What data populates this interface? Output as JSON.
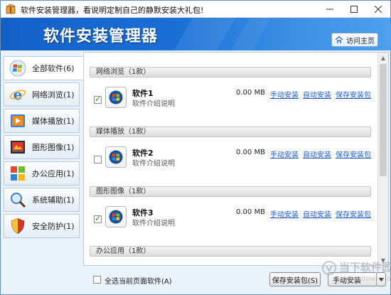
{
  "window": {
    "title": "软件安装管理器，看说明定制自己的静默安装大礼包!",
    "icon": "app-package-icon"
  },
  "banner": {
    "title": "软件安装管理器",
    "visit_label": "访问主页"
  },
  "sidebar": {
    "items": [
      {
        "label": "全部软件(6)",
        "icon": "windows-logo-icon"
      },
      {
        "label": "网络浏览(1)",
        "icon": "ie-browser-icon"
      },
      {
        "label": "媒体播放(1)",
        "icon": "media-play-icon"
      },
      {
        "label": "图形图像(1)",
        "icon": "image-editor-icon"
      },
      {
        "label": "办公应用(1)",
        "icon": "office-icon"
      },
      {
        "label": "系统辅助(1)",
        "icon": "magnifier-icon"
      },
      {
        "label": "安全防护(1)",
        "icon": "shield-icon"
      }
    ]
  },
  "content": {
    "categories": [
      {
        "label": "网络浏览（1款）"
      },
      {
        "label": "媒体播放（1款）"
      },
      {
        "label": "图形图像（1款）"
      },
      {
        "label": "办公应用（1款）"
      }
    ],
    "software": [
      {
        "name": "软件1",
        "desc": "软件介绍说明",
        "size": "0.00 MB",
        "manual": "手动安装",
        "auto": "自动安装",
        "save": "保存安装包",
        "checked": true
      },
      {
        "name": "软件2",
        "desc": "软件介绍说明",
        "size": "0.00 MB",
        "manual": "手动安装",
        "auto": "自动安装",
        "save": "保存安装包",
        "checked": false
      },
      {
        "name": "软件3",
        "desc": "软件介绍说明",
        "size": "0.00 MB",
        "manual": "手动安装",
        "auto": "自动安装",
        "save": "保存安装包",
        "checked": true
      }
    ]
  },
  "footer": {
    "select_all_label": "全选当前页面软件(A)",
    "save_label": "保存安装包(S)",
    "manual_label": "手动安装"
  },
  "watermark": {
    "text": "当下软件园",
    "url": "www.downxia.com"
  }
}
